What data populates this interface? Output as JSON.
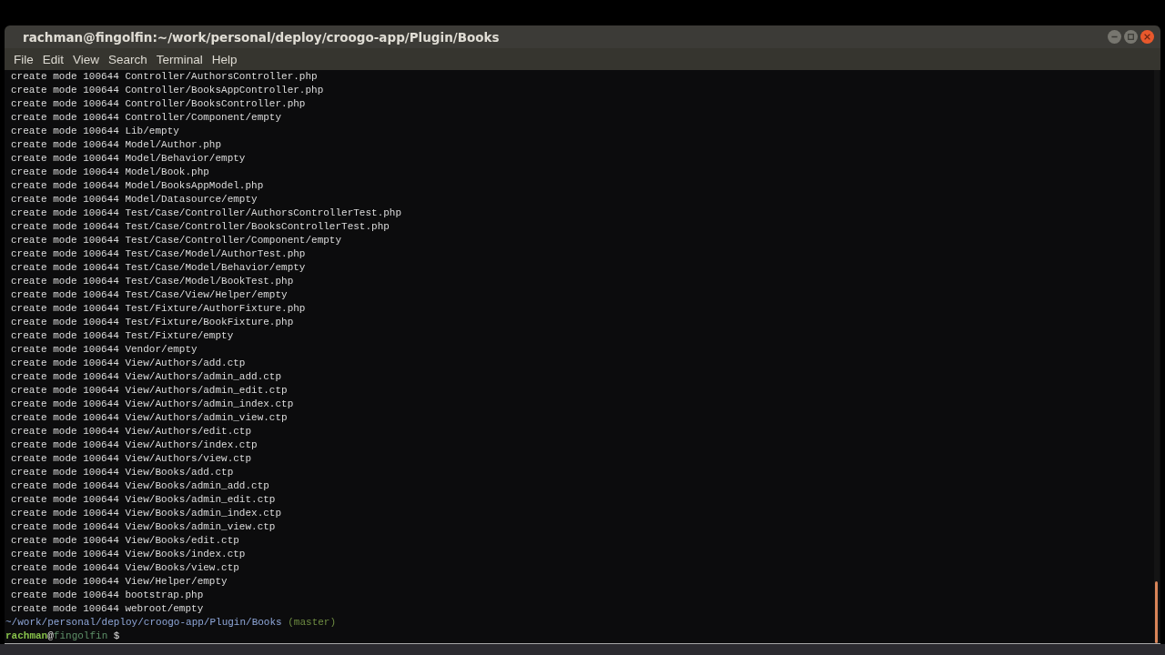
{
  "window": {
    "title": "rachman@fingolfin:~/work/personal/deploy/croogo-app/Plugin/Books"
  },
  "menu": [
    "File",
    "Edit",
    "View",
    "Search",
    "Terminal",
    "Help"
  ],
  "terminal": {
    "lines": [
      "create mode 100644 Controller/AuthorsController.php",
      "create mode 100644 Controller/BooksAppController.php",
      "create mode 100644 Controller/BooksController.php",
      "create mode 100644 Controller/Component/empty",
      "create mode 100644 Lib/empty",
      "create mode 100644 Model/Author.php",
      "create mode 100644 Model/Behavior/empty",
      "create mode 100644 Model/Book.php",
      "create mode 100644 Model/BooksAppModel.php",
      "create mode 100644 Model/Datasource/empty",
      "create mode 100644 Test/Case/Controller/AuthorsControllerTest.php",
      "create mode 100644 Test/Case/Controller/BooksControllerTest.php",
      "create mode 100644 Test/Case/Controller/Component/empty",
      "create mode 100644 Test/Case/Model/AuthorTest.php",
      "create mode 100644 Test/Case/Model/Behavior/empty",
      "create mode 100644 Test/Case/Model/BookTest.php",
      "create mode 100644 Test/Case/View/Helper/empty",
      "create mode 100644 Test/Fixture/AuthorFixture.php",
      "create mode 100644 Test/Fixture/BookFixture.php",
      "create mode 100644 Test/Fixture/empty",
      "create mode 100644 Vendor/empty",
      "create mode 100644 View/Authors/add.ctp",
      "create mode 100644 View/Authors/admin_add.ctp",
      "create mode 100644 View/Authors/admin_edit.ctp",
      "create mode 100644 View/Authors/admin_index.ctp",
      "create mode 100644 View/Authors/admin_view.ctp",
      "create mode 100644 View/Authors/edit.ctp",
      "create mode 100644 View/Authors/index.ctp",
      "create mode 100644 View/Authors/view.ctp",
      "create mode 100644 View/Books/add.ctp",
      "create mode 100644 View/Books/admin_add.ctp",
      "create mode 100644 View/Books/admin_edit.ctp",
      "create mode 100644 View/Books/admin_index.ctp",
      "create mode 100644 View/Books/admin_view.ctp",
      "create mode 100644 View/Books/edit.ctp",
      "create mode 100644 View/Books/index.ctp",
      "create mode 100644 View/Books/view.ctp",
      "create mode 100644 View/Helper/empty",
      "create mode 100644 bootstrap.php",
      "create mode 100644 webroot/empty"
    ],
    "cwd": {
      "path": "~/work/personal/deploy/croogo-app/Plugin/Books",
      "branch": "(master)"
    },
    "prompt": {
      "user": "rachman",
      "at": "@",
      "host": "fingolfin",
      "symbol": "$"
    }
  }
}
